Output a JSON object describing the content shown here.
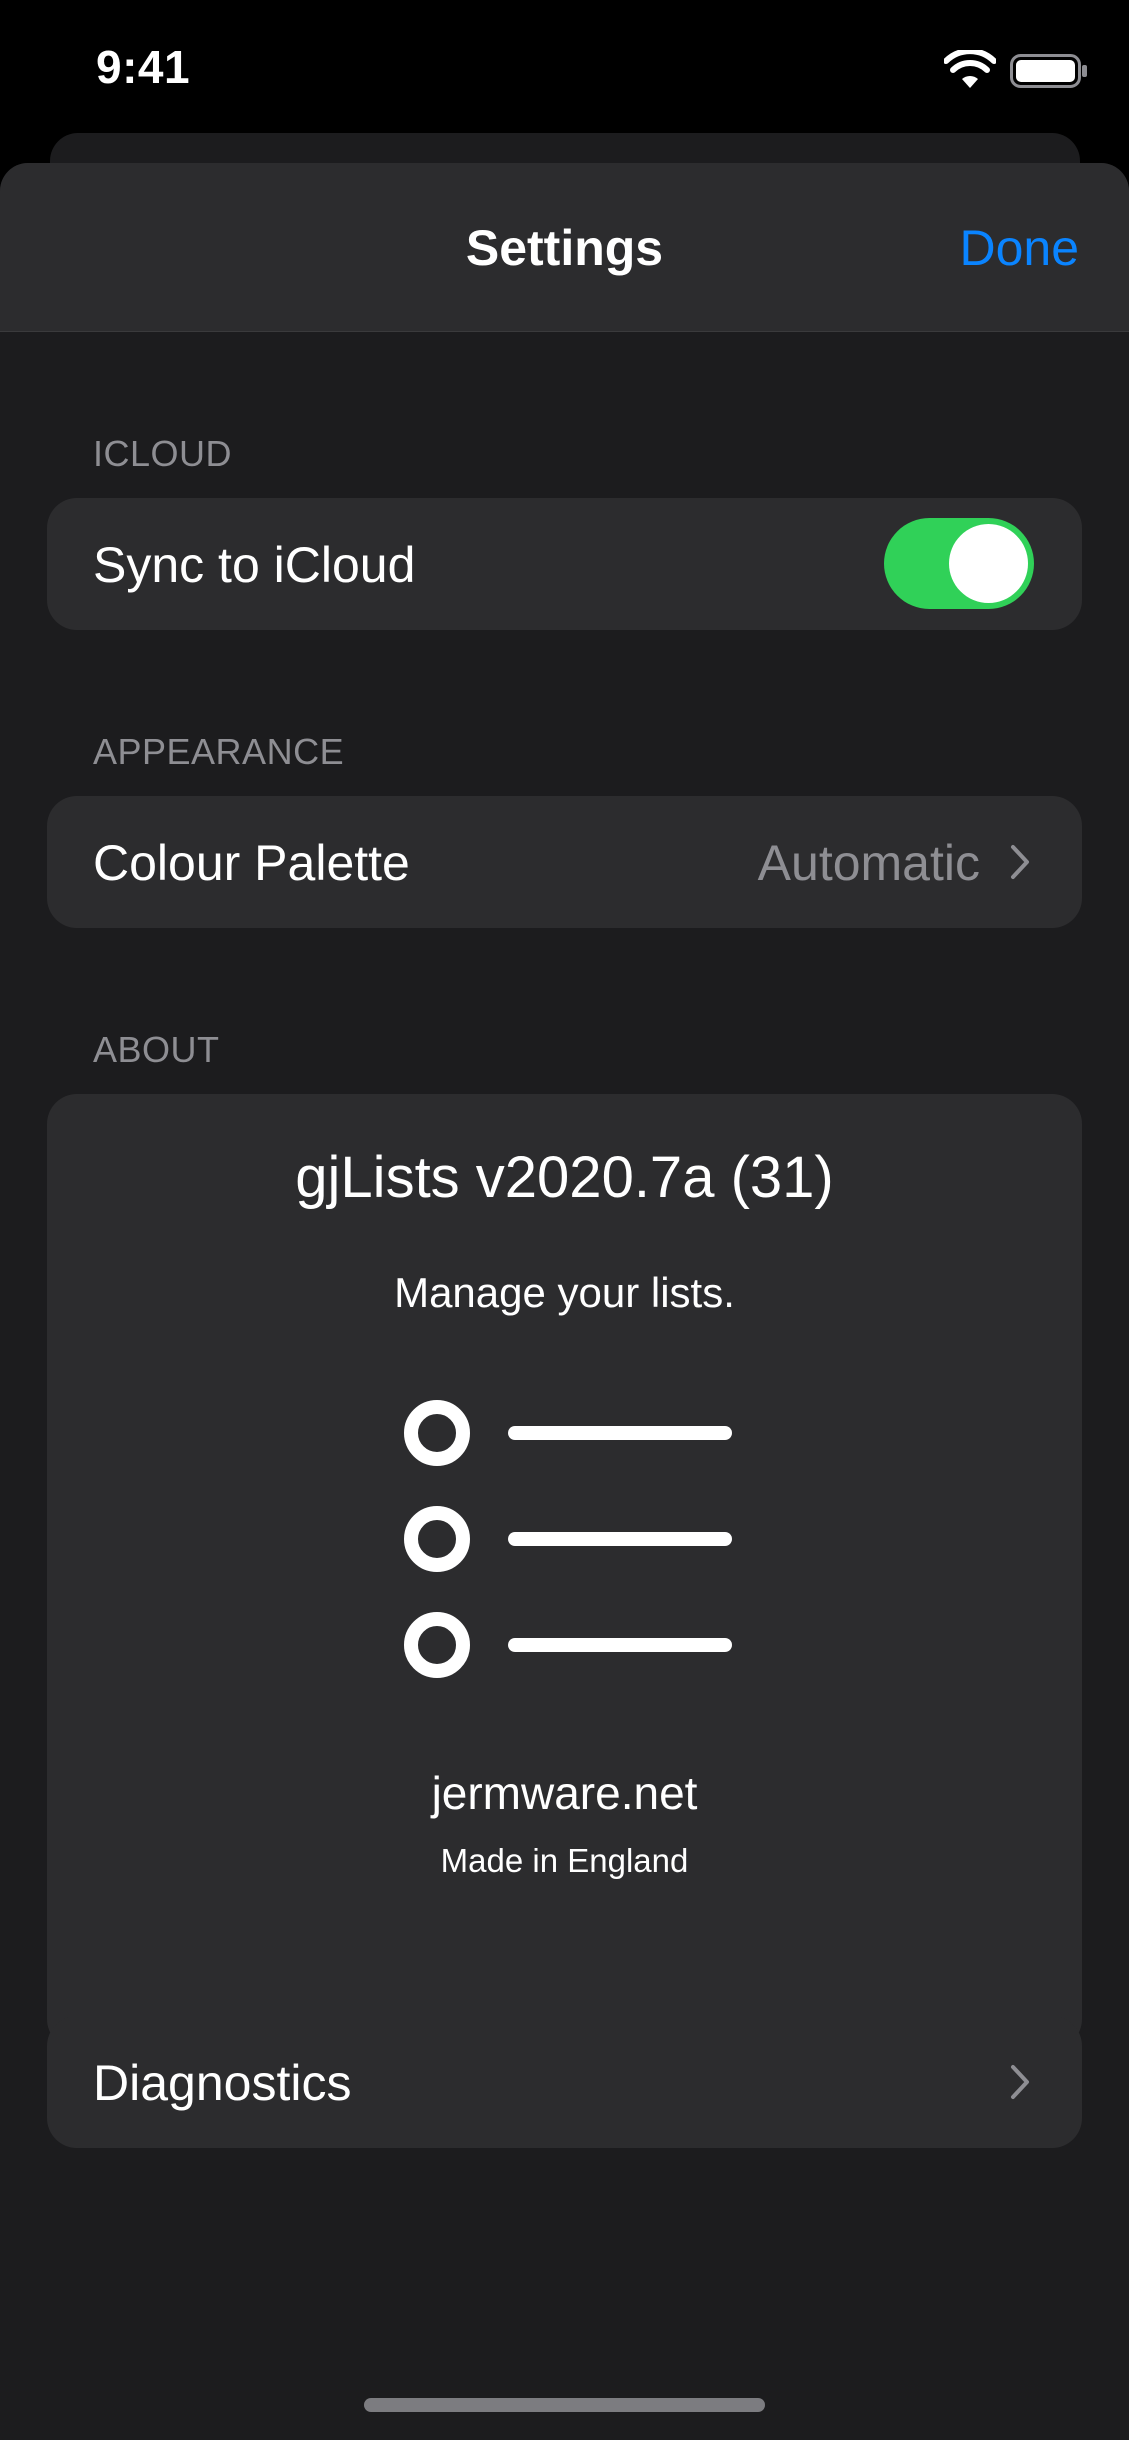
{
  "status_bar": {
    "time": "9:41"
  },
  "nav": {
    "title": "Settings",
    "done_label": "Done"
  },
  "icloud": {
    "header": "ICLOUD",
    "sync_label": "Sync to iCloud",
    "sync_enabled": true
  },
  "appearance": {
    "header": "APPEARANCE",
    "palette_label": "Colour Palette",
    "palette_value": "Automatic"
  },
  "about": {
    "header": "ABOUT",
    "app_title": "gjLists v2020.7a (31)",
    "tagline": "Manage your lists.",
    "website": "jermware.net",
    "made_in": "Made in England"
  },
  "diagnostics": {
    "label": "Diagnostics"
  },
  "colors": {
    "accent": "#0a84ff",
    "toggle_on": "#30d158",
    "background": "#1c1c1e",
    "cell": "#2c2c2e",
    "secondary_text": "#8e8e93"
  },
  "icons": [
    "wifi-icon",
    "battery-icon",
    "chevron-right-icon",
    "app-logo-icon"
  ]
}
